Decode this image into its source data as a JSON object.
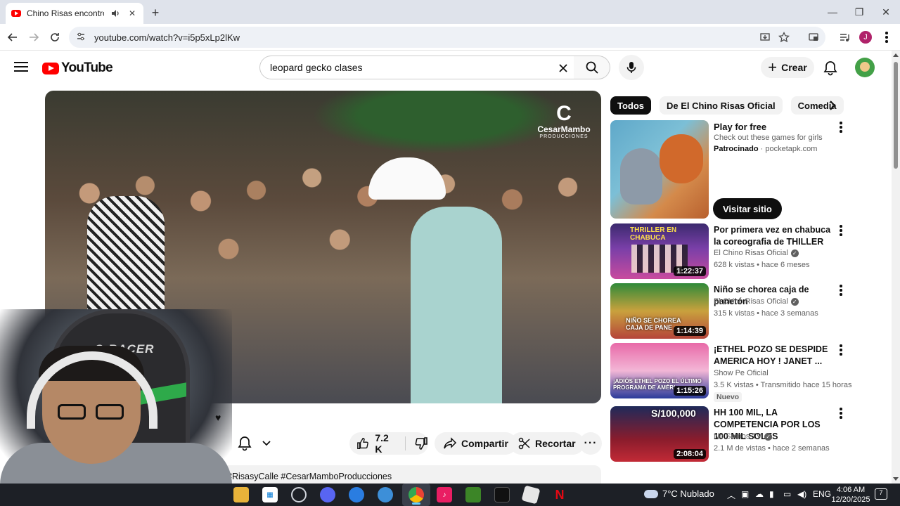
{
  "browser": {
    "tab_title": "Chino Risas encontró el am",
    "address": "youtube.com/watch?v=i5p5xLp2lKw",
    "profile_initial": "J"
  },
  "youtube": {
    "logo_text": "YouTube",
    "search_value": "leopard gecko clases",
    "create_label": "Crear"
  },
  "player": {
    "watermark_name": "CesarMambo",
    "watermark_sub": "PRODUCCIONES"
  },
  "webcam": {
    "chair_text": "S-RACER"
  },
  "actions": {
    "likes": "7.2 K",
    "share": "Compartir",
    "clip": "Recortar"
  },
  "description": {
    "tags": "icial #RisasyCalle #CesarMamboProducciones"
  },
  "chips": [
    "Todos",
    "De El Chino Risas Oficial",
    "Comedia"
  ],
  "ad": {
    "title": "Play for free",
    "description": "Check out these games for girls",
    "sponsored": "Patrocinado",
    "domain": "pocketapk.com",
    "cta": "Visitar sitio"
  },
  "recommendations": [
    {
      "title": "Por primera vez en chabuca la coreografia de THILLER",
      "channel": "El Chino Risas Oficial",
      "verified": true,
      "meta": "628 k vistas • hace 6 meses",
      "duration": "1:22:37",
      "thumb_text": "THRILLER EN CHABUCA"
    },
    {
      "title": "Niño se chorea caja de panetón",
      "channel": "El Chino Risas Oficial",
      "verified": true,
      "meta": "315 k vistas • hace 3 semanas",
      "duration": "1:14:39",
      "thumb_text": "NIÑO SE CHOREA CAJA DE PANE"
    },
    {
      "title": "¡ETHEL POZO SE DESPIDE AMERICA HOY ! JANET ...",
      "channel": "Show Pe Oficial",
      "verified": false,
      "meta": "3.5 K vistas • Transmitido hace 15 horas",
      "badge": "Nuevo",
      "duration": "1:15:26",
      "thumb_text": "¡ADIÓS ETHEL POZO EL ÚLTIMO PROGRAMA DE AMÉRI"
    },
    {
      "title": "HH 100 MIL, LA COMPETENCIA POR LOS 100 MIL SOLES",
      "channel": "No Somos TV",
      "verified": true,
      "meta": "2.1 M de vistas • hace 2 semanas",
      "duration": "2:08:04",
      "thumb_text": "S/100,000"
    }
  ],
  "taskbar": {
    "weather": "7°C  Nublado",
    "language": "ENG",
    "time": "4:06 AM",
    "date": "12/20/2025",
    "notifications": "7"
  }
}
